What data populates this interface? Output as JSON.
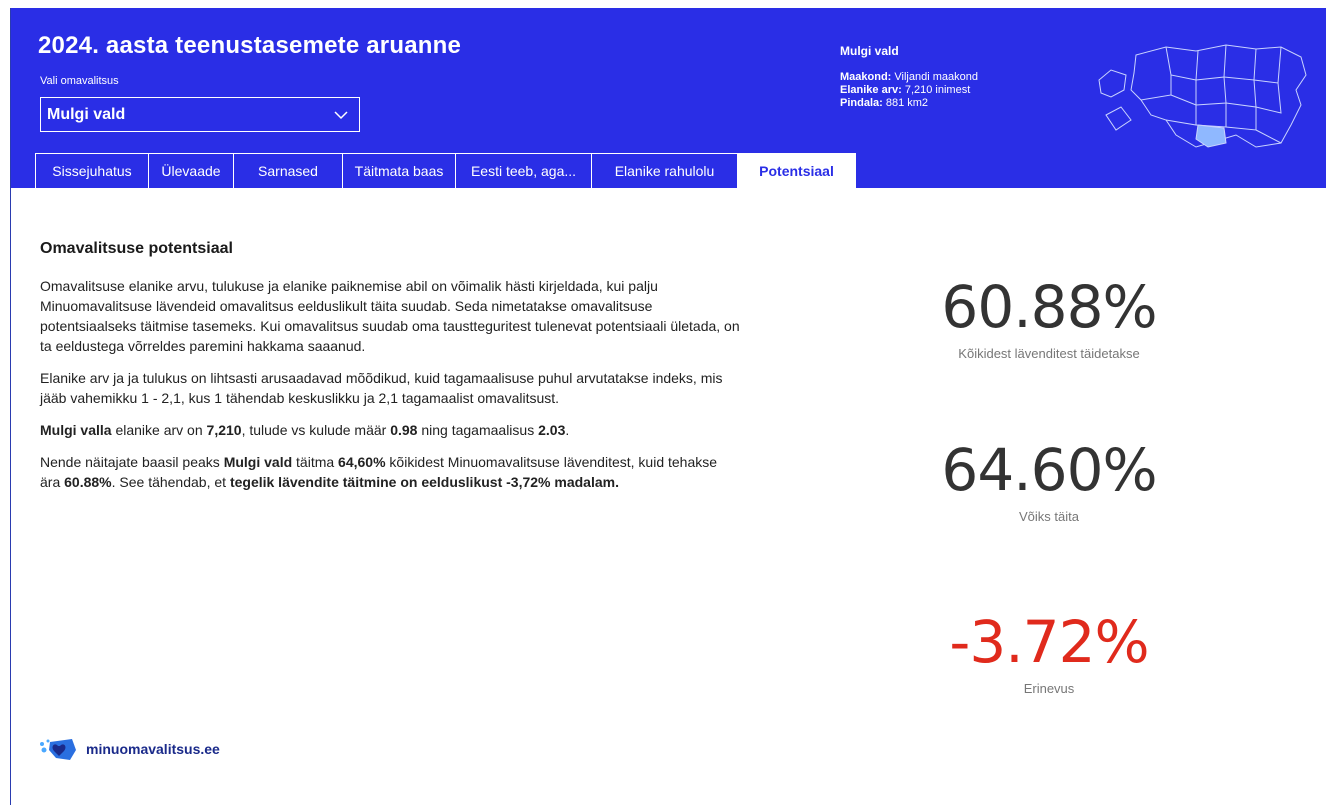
{
  "header": {
    "title": "2024. aasta teenustasemete aruanne",
    "select_label": "Vali omavalitsus",
    "selected_municipality": "Mulgi vald",
    "info": {
      "name": "Mulgi vald",
      "county_label": "Maakond:",
      "county_value": "Viljandi maakond",
      "population_label": "Elanike arv:",
      "population_value": "7,210 inimest",
      "area_label": "Pindala:",
      "area_value": "881 km2"
    }
  },
  "tabs": [
    {
      "label": "Sissejuhatus"
    },
    {
      "label": "Ülevaade"
    },
    {
      "label": "Sarnased"
    },
    {
      "label": "Täitmata baas"
    },
    {
      "label": "Eesti teeb, aga..."
    },
    {
      "label": "Elanike rahulolu"
    },
    {
      "label": "Potentsiaal",
      "active": true
    }
  ],
  "content": {
    "section_title": "Omavalitsuse potentsiaal",
    "p1": "Omavalitsuse elanike arvu, tulukuse ja elanike paiknemise abil on võimalik hästi kirjeldada, kui palju Minuomavalitsuse lävendeid omavalitsus eelduslikult täita suudab. Seda nimetatakse omavalitsuse potentsiaalseks täitmise tasemeks. Kui omavalitsus suudab oma taustteguritest tulenevat potentsiaali ületada, on ta eeldustega võrreldes paremini hakkama saaanud.",
    "p2": "Elanike arv ja ja tulukus on lihtsasti arusaadavad mõõdikud, kuid tagamaalisuse puhul arvutatakse indeks, mis jääb vahemikku 1 - 2,1, kus 1 tähendab keskuslikku ja 2,1 tagamaalist omavalitsust.",
    "p3": {
      "name": "Mulgi valla",
      "t1": " elanike arv on ",
      "population": "7,210",
      "t2": ", tulude vs kulude määr ",
      "ratio": "0.98",
      "t3": " ning tagamaalisus ",
      "remoteness": "2.03",
      "t4": "."
    },
    "p4": {
      "t1": "Nende näitajate baasil peaks ",
      "name": "Mulgi vald",
      "t2": " täitma ",
      "expected": "64,60%",
      "t3": " kõikidest Minuomavalitsuse lävenditest, kuid tehakse ära ",
      "actual": "60.88%",
      "t4": ". See tähendab, et ",
      "conclusion": "tegelik lävendite täitmine on eelduslikust -3,72% madalam."
    }
  },
  "kpis": [
    {
      "value": "60.88%",
      "label": "Kõikidest lävenditest täidetakse"
    },
    {
      "value": "64.60%",
      "label": "Võiks täita"
    },
    {
      "value": "-3.72%",
      "label": "Erinevus"
    }
  ],
  "footer": {
    "logo_text": "minuomavalitsus.ee"
  },
  "colors": {
    "header_bg": "#2a2ee6",
    "negative": "#e02a1c",
    "map_highlight": "#8fb8ff"
  }
}
